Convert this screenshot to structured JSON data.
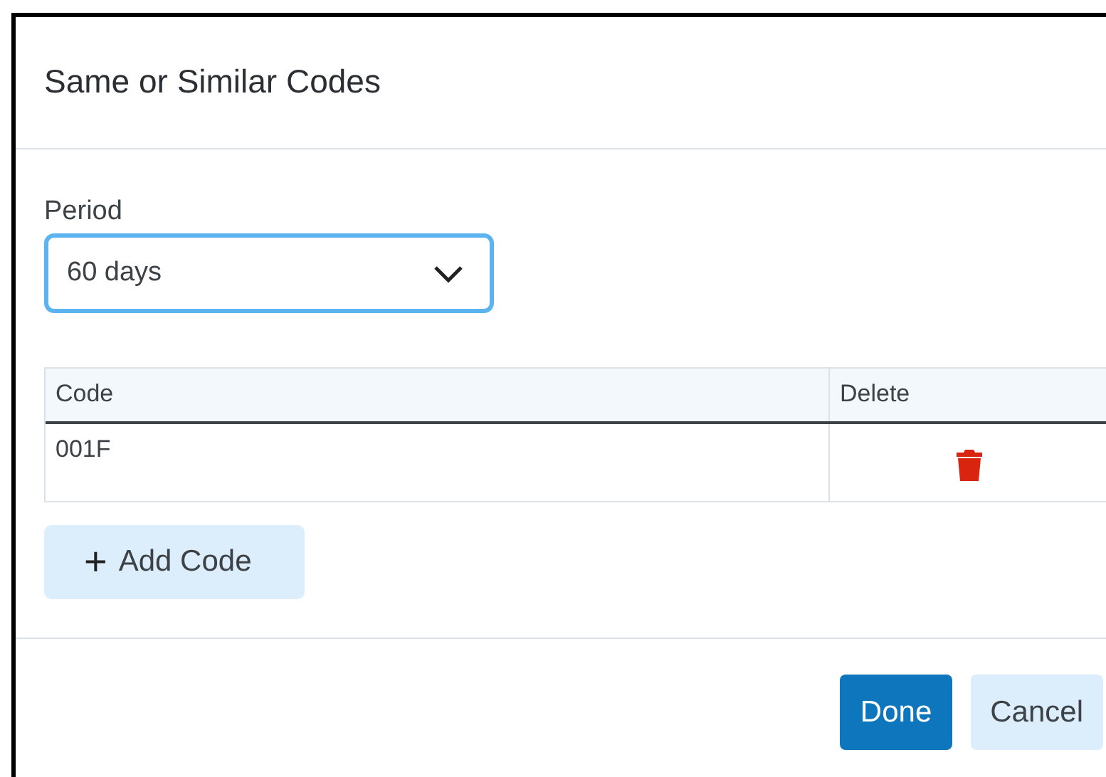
{
  "dialog": {
    "title": "Same or Similar Codes"
  },
  "period": {
    "label": "Period",
    "value": "60 days"
  },
  "table": {
    "columns": [
      "Code",
      "Delete"
    ],
    "rows": [
      {
        "code": "001F"
      }
    ]
  },
  "add_button": {
    "icon": "+",
    "label": "Add Code"
  },
  "buttons": [
    {
      "label": "Done",
      "kind": "primary"
    },
    {
      "label": "Cancel",
      "kind": "secondary"
    }
  ]
}
